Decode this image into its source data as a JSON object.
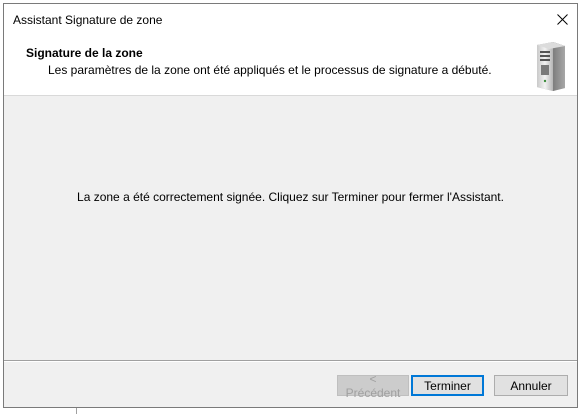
{
  "window": {
    "title": "Assistant Signature de zone",
    "close_icon": "close-icon"
  },
  "header": {
    "title": "Signature de la zone",
    "subtitle": "Les paramètres de la zone ont été appliqués et le processus de signature a débuté.",
    "icon": "server-icon"
  },
  "body": {
    "message": "La zone a été correctement signée. Cliquez sur Terminer pour fermer l'Assistant."
  },
  "buttons": {
    "previous_label": "< Précédent",
    "finish_label": "Terminer",
    "cancel_label": "Annuler"
  },
  "colors": {
    "dialog_bg": "#f0f0f0",
    "header_bg": "#ffffff",
    "default_button_border": "#0078d7"
  }
}
